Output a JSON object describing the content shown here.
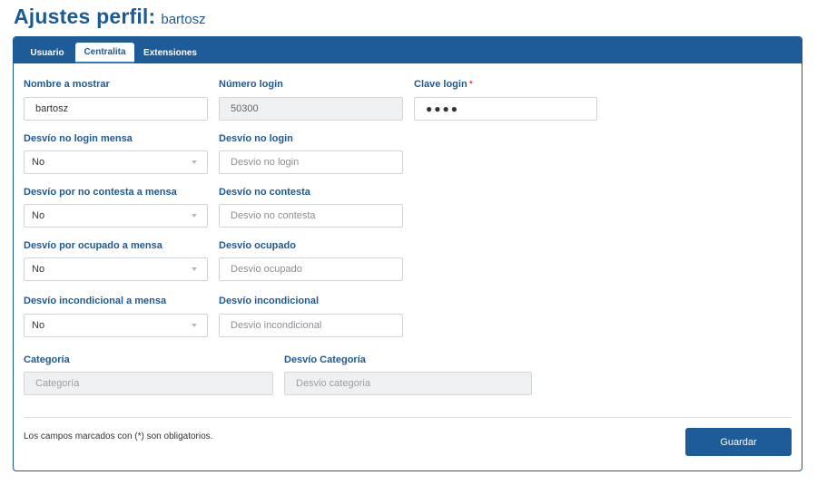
{
  "header": {
    "title": "Ajustes perfil:",
    "username": "bartosz"
  },
  "tabs": [
    {
      "label": "Usuario",
      "active": false
    },
    {
      "label": "Centralita",
      "active": true
    },
    {
      "label": "Extensiones",
      "active": false
    }
  ],
  "form": {
    "nombre": {
      "label": "Nombre a mostrar",
      "value": "bartosz"
    },
    "numero_login": {
      "label": "Número login",
      "value": "50300"
    },
    "clave_login": {
      "label": "Clave login",
      "required_mark": "*",
      "value": "●●●●"
    },
    "desvio_no_login_mensa": {
      "label": "Desvío no login mensa",
      "value": "No"
    },
    "desvio_no_login": {
      "label": "Desvío no login",
      "placeholder": "Desvio no login"
    },
    "desvio_no_contesta_mensa": {
      "label": "Desvío por no contesta a mensa",
      "value": "No"
    },
    "desvio_no_contesta": {
      "label": "Desvío no contesta",
      "placeholder": "Desvio no contesta"
    },
    "desvio_ocupado_mensa": {
      "label": "Desvío por ocupado a mensa",
      "value": "No"
    },
    "desvio_ocupado": {
      "label": "Desvío ocupado",
      "placeholder": "Desvio ocupado"
    },
    "desvio_incondicional_mensa": {
      "label": "Desvío incondicional a mensa",
      "value": "No"
    },
    "desvio_incondicional": {
      "label": "Desvío incondicional",
      "placeholder": "Desvio incondicional"
    },
    "categoria": {
      "label": "Categoría",
      "placeholder": "Categoría"
    },
    "desvio_categoria": {
      "label": "Desvío Categoría",
      "placeholder": "Desvio categoria"
    }
  },
  "footer": {
    "note": "Los campos marcados con (*) son obligatorios.",
    "save_label": "Guardar"
  },
  "colors": {
    "accent": "#1e5c99",
    "label": "#1c5a96",
    "required": "#d02020"
  }
}
